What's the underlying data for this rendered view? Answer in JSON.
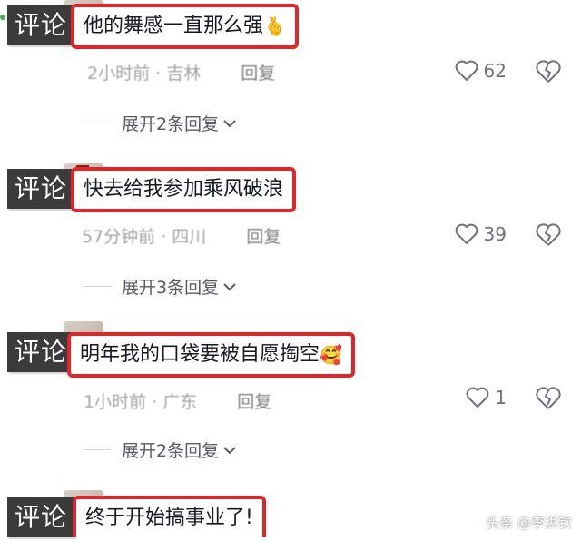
{
  "comments": [
    {
      "tag": "评论",
      "text": "他的舞感一直那么强",
      "emoji": "🫰",
      "meta": "2小时前 · 吉林",
      "reply_label": "回复",
      "likes": "62",
      "expand_label": "展开2条回复"
    },
    {
      "tag": "评论",
      "text": "快去给我参加乘风破浪",
      "emoji": "",
      "meta": "57分钟前 · 四川",
      "reply_label": "回复",
      "likes": "39",
      "expand_label": "展开3条回复"
    },
    {
      "tag": "评论",
      "text": "明年我的口袋要被自愿掏空",
      "emoji": "🥰",
      "meta": "1小时前 · 广东",
      "reply_label": "回复",
      "likes": "1",
      "expand_label": "展开2条回复"
    },
    {
      "tag": "评论",
      "text": "终于开始搞事业了!",
      "emoji": "",
      "meta": "",
      "reply_label": "",
      "likes": "",
      "expand_label": ""
    }
  ],
  "watermark": "头条 @李洪钦",
  "colors": {
    "highlight_border": "#e0262b",
    "tag_bg": "#3b3b3b"
  }
}
